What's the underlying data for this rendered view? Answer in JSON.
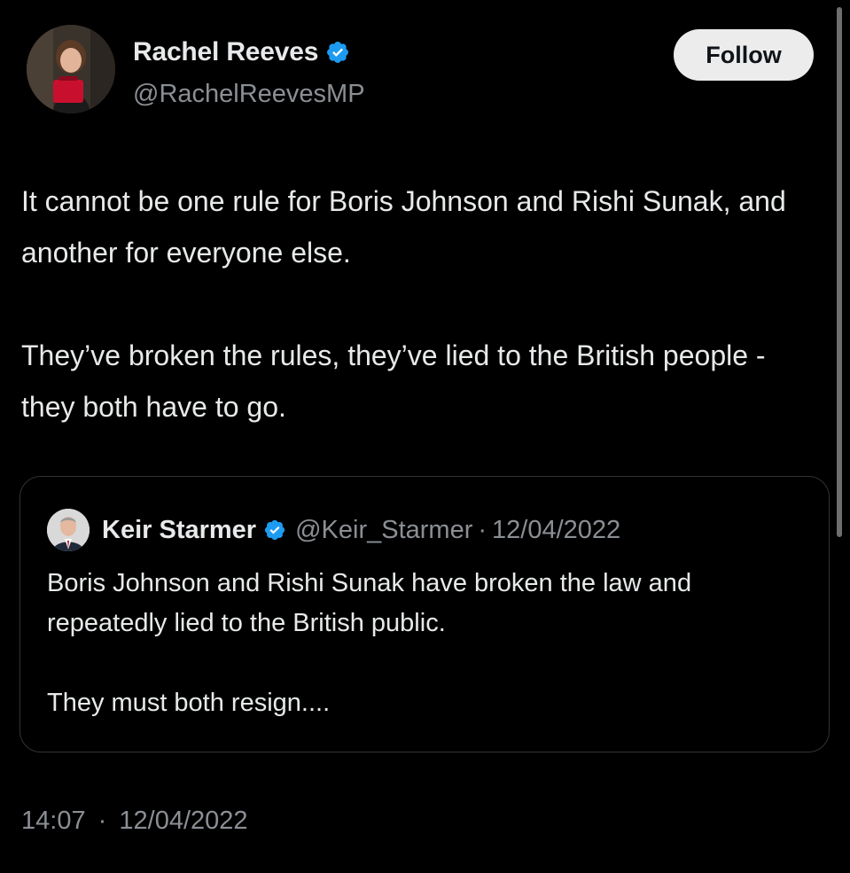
{
  "author": {
    "name": "Rachel Reeves",
    "handle": "@RachelReevesMP",
    "verified_icon": "verified-badge-icon",
    "follow_label": "Follow"
  },
  "tweet": {
    "paragraphs": [
      "It cannot be one rule for Boris Johnson and Rishi Sunak, and another for everyone else.",
      "They’ve broken the rules, they’ve lied to the British people - they both have to go."
    ],
    "time": "14:07",
    "separator": "·",
    "date": "12/04/2022"
  },
  "quoted_tweet": {
    "name": "Keir Starmer",
    "handle": "@Keir_Starmer",
    "separator": "·",
    "date": "12/04/2022",
    "paragraphs": [
      "Boris Johnson and Rishi Sunak have broken the law and repeatedly lied to the British public.",
      "They must both resign...."
    ]
  },
  "colors": {
    "background": "#000000",
    "text_primary": "#e7e9ea",
    "text_secondary": "#8b8f94",
    "verified_blue": "#1d9bf0",
    "border": "#2f3336",
    "follow_bg": "#ececec"
  }
}
